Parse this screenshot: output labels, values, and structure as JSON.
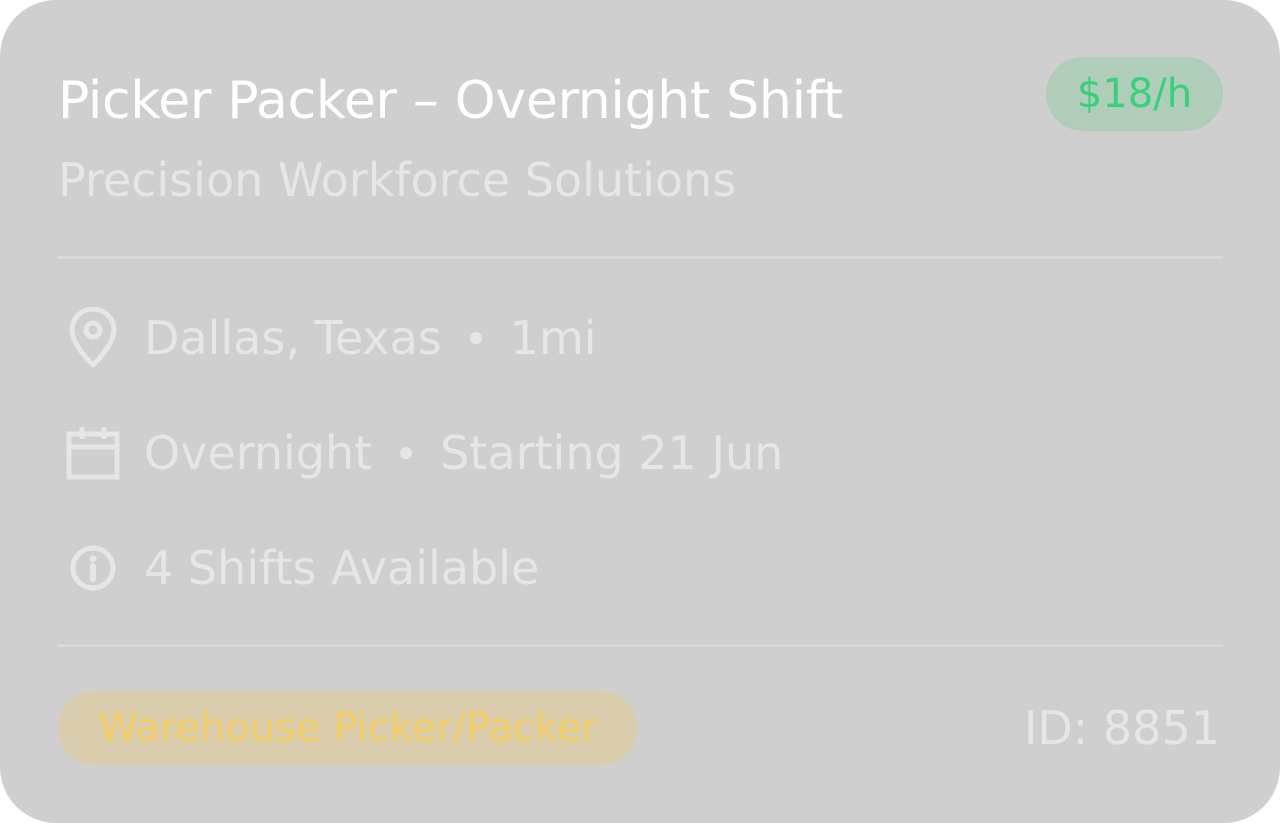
{
  "job": {
    "title": "Picker Packer – Overnight Shift",
    "company": "Precision Workforce Solutions",
    "rate": "$18/h",
    "location": "Dallas, Texas",
    "distance": "1mi",
    "shift_type": "Overnight",
    "start": "Starting 21 Jun",
    "shifts_available": "4 Shifts Available",
    "category_tag": "Warehouse Picker/Packer",
    "id_label": "ID: 8851"
  },
  "icons": {
    "location": "map-pin-icon",
    "date": "calendar-icon",
    "info": "info-icon"
  },
  "colors": {
    "card_bg": "#cfcfcf",
    "rate_text": "#35d27b",
    "rate_bg": "#b0cdb9",
    "tag_text": "#f5cf63",
    "tag_bg": "#d9cdae"
  }
}
